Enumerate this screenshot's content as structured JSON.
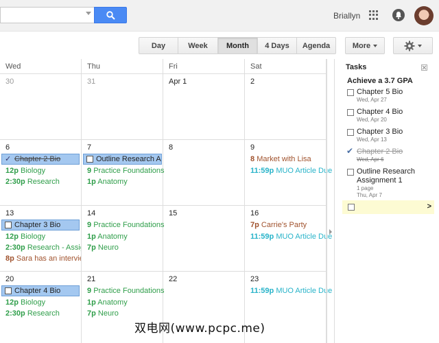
{
  "header": {
    "search_value": "",
    "username": "Briallyn"
  },
  "views": {
    "day": "Day",
    "week": "Week",
    "month": "Month",
    "four_days": "4 Days",
    "agenda": "Agenda",
    "more": "More",
    "active": "Month"
  },
  "calendar": {
    "headers": [
      "Wed",
      "Thu",
      "Fri",
      "Sat"
    ],
    "weeks": [
      [
        {
          "day": "30",
          "other": true
        },
        {
          "day": "31",
          "other": true
        },
        {
          "day": "Apr 1"
        },
        {
          "day": "2"
        }
      ],
      [
        {
          "day": "6"
        },
        {
          "day": "7"
        },
        {
          "day": "8"
        },
        {
          "day": "9"
        }
      ],
      [
        {
          "day": "13"
        },
        {
          "day": "14"
        },
        {
          "day": "15"
        },
        {
          "day": "16"
        }
      ],
      [
        {
          "day": "20"
        },
        {
          "day": "21"
        },
        {
          "day": "22"
        },
        {
          "day": "23"
        }
      ]
    ],
    "events": {
      "w2_wed_task": "Chapter 2 Bio",
      "w2_wed_e1_time": "12p",
      "w2_wed_e1_title": "Biology",
      "w2_wed_e2_time": "2:30p",
      "w2_wed_e2_title": "Research",
      "w2_thu_task": "Outline Research As",
      "w2_thu_e1_time": "9",
      "w2_thu_e1_title": "Practice Foundations",
      "w2_thu_e2_time": "1p",
      "w2_thu_e2_title": "Anatomy",
      "w2_sat_e1_time": "8",
      "w2_sat_e1_title": "Market with Lisa",
      "w2_sat_e2_time": "11:59p",
      "w2_sat_e2_title": "MUO Article Due",
      "w3_wed_task": "Chapter 3 Bio",
      "w3_wed_e1_time": "12p",
      "w3_wed_e1_title": "Biology",
      "w3_wed_e2_time": "2:30p",
      "w3_wed_e2_title": "Research - Assign",
      "w3_wed_e3_time": "8p",
      "w3_wed_e3_title": "Sara has an interview",
      "w3_thu_e1_time": "9",
      "w3_thu_e1_title": "Practice Foundations",
      "w3_thu_e2_time": "1p",
      "w3_thu_e2_title": "Anatomy",
      "w3_thu_e3_time": "7p",
      "w3_thu_e3_title": "Neuro",
      "w3_sat_e1_time": "7p",
      "w3_sat_e1_title": "Carrie's Party",
      "w3_sat_e2_time": "11:59p",
      "w3_sat_e2_title": "MUO Article Due",
      "w4_wed_task": "Chapter 4 Bio",
      "w4_wed_e1_time": "12p",
      "w4_wed_e1_title": "Biology",
      "w4_wed_e2_time": "2:30p",
      "w4_wed_e2_title": "Research",
      "w4_thu_e1_time": "9",
      "w4_thu_e1_title": "Practice Foundations",
      "w4_thu_e2_time": "1p",
      "w4_thu_e2_title": "Anatomy",
      "w4_thu_e3_time": "7p",
      "w4_thu_e3_title": "Neuro",
      "w4_sat_e1_time": "11:59p",
      "w4_sat_e1_title": "MUO Article Due"
    }
  },
  "tasks": {
    "title": "Tasks",
    "list_name": "Achieve a 3.7 GPA",
    "items": [
      {
        "title": "Chapter 5 Bio",
        "due": "Wed, Apr 27",
        "done": false
      },
      {
        "title": "Chapter 4 Bio",
        "due": "Wed, Apr 20",
        "done": false
      },
      {
        "title": "Chapter 3 Bio",
        "due": "Wed, Apr 13",
        "done": false
      },
      {
        "title": "Chapter 2 Bio",
        "due": "Wed, Apr 6",
        "done": true
      },
      {
        "title": "Outline Research Assignment 1",
        "note": "1 page",
        "due": "Thu, Apr 7",
        "done": false
      }
    ]
  },
  "watermark": "双电网(www.pcpc.me)",
  "colors": {
    "accent_blue": "#4a8af4",
    "task_chip": "#a4c8f0",
    "event_green": "#2f9e4a",
    "event_brown": "#a0522d",
    "event_teal": "#27b3c9"
  }
}
